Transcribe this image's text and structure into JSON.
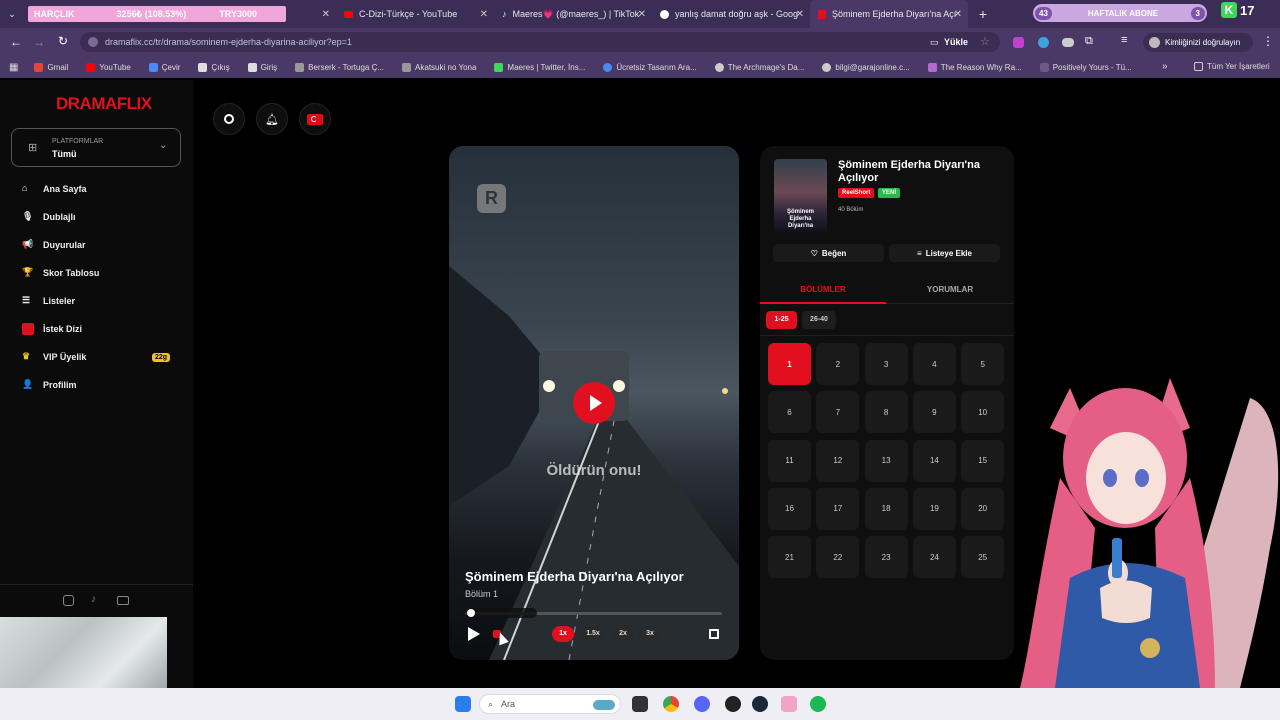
{
  "browser": {
    "tabs": [
      {
        "title": "HARÇLIK",
        "extra1": "3256₺ (108.53%)",
        "extra2": "TRY3000"
      },
      {
        "title": "C-Dizi-Türkçe - YouTube"
      },
      {
        "title": "Maeres💗 (@maeres_) | TikTok"
      },
      {
        "title": "yanlış damat doğru aşk - Goog"
      },
      {
        "title": "Şöminem Ejderha Diyarı'na Açı"
      }
    ],
    "widget": {
      "left": "43",
      "label": "HAFTALIK ABONE",
      "right": "3",
      "count": "17"
    },
    "url": "dramaflix.cc/tr/drama/sominem-ejderha-diyarina-aciliyor?ep=1",
    "install_label": "Yükle",
    "verify_label": "Kimliğinizi doğrulayın",
    "bookmarks": [
      "Gmail",
      "YouTube",
      "Çevir",
      "Çıkış",
      "Giriş",
      "Berserk - Tortuga Ç...",
      "Akatsuki no Yona",
      "Maeres | Twitter, İns...",
      "Ücretsiz Tasarım Ara...",
      "The Archmage's Da...",
      "bilgi@garajonline.c...",
      "The Reason Why Ra...",
      "Positively Yours - Tü..."
    ],
    "bookmarks_more": "»",
    "all_bookmarks": "Tüm Yer İşaretleri"
  },
  "sidebar": {
    "logo": "DRAMAFLIX",
    "platform_label": "PLATFORMLAR",
    "platform_value": "Tümü",
    "items": [
      {
        "label": "Ana Sayfa",
        "icon": "home-icon"
      },
      {
        "label": "Dublajlı",
        "icon": "mic-icon"
      },
      {
        "label": "Duyurular",
        "icon": "megaphone-icon"
      },
      {
        "label": "Skor Tablosu",
        "icon": "trophy-icon"
      },
      {
        "label": "Listeler",
        "icon": "list-icon"
      },
      {
        "label": "İstek Dizi",
        "icon": "request-icon"
      },
      {
        "label": "VIP Üyelik",
        "icon": "crown-icon",
        "badge": "22g"
      },
      {
        "label": "Profilim",
        "icon": "user-icon"
      }
    ]
  },
  "player": {
    "subtitle": "Öldürün onu!",
    "title": "Şöminem Ejderha Diyarı'na Açılıyor",
    "episode": "Bölüm 1",
    "progress": 0.03,
    "speeds": [
      "1x",
      "1.5x",
      "2x",
      "3x"
    ]
  },
  "detail": {
    "title": "Şöminem Ejderha Diyarı'na Açılıyor",
    "badge1": "ReelShort",
    "badge2": "YENİ",
    "count": "40 Bölüm",
    "poster_text": "Şöminem Ejderha Diyarı'na",
    "like": "Beğen",
    "addlist": "Listeye Ekle",
    "tab_episodes": "BÖLÜMLER",
    "tab_comments": "YORUMLAR",
    "range1": "1-25",
    "range2": "26-40",
    "episodes": [
      "1",
      "2",
      "3",
      "4",
      "5",
      "6",
      "7",
      "8",
      "9",
      "10",
      "11",
      "12",
      "13",
      "14",
      "15",
      "16",
      "17",
      "18",
      "19",
      "20",
      "21",
      "22",
      "23",
      "24",
      "25"
    ]
  },
  "taskbar": {
    "search": "Ara"
  },
  "colors": {
    "accent": "#e2101e",
    "browser_tab": "#3c2d57",
    "toolbar": "#4a3966"
  }
}
